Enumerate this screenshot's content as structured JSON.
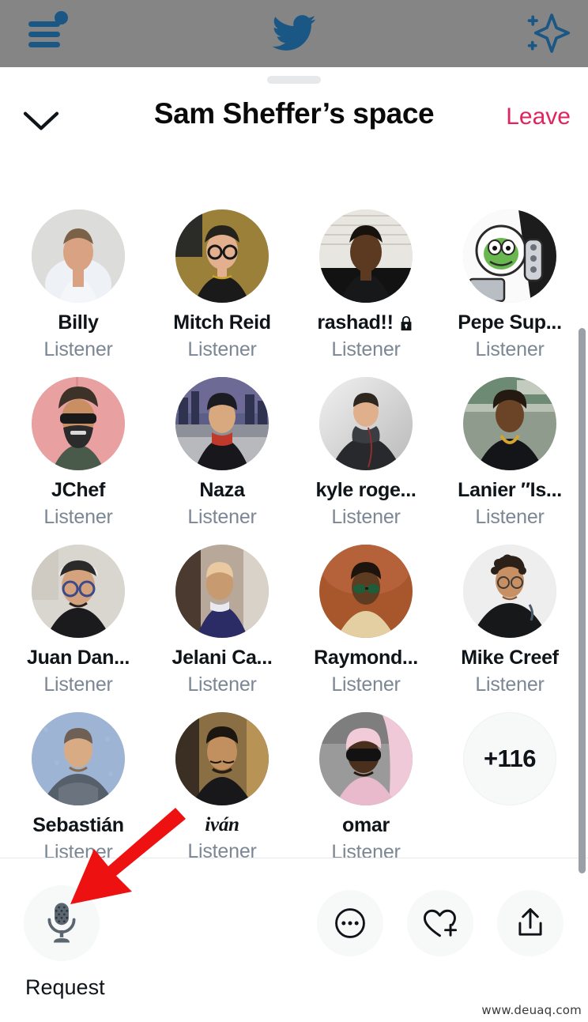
{
  "appbar": {
    "menu_icon": "hamburger-menu-icon",
    "menu_badge": "unread-dot-badge",
    "logo_icon": "twitter-bird-logo",
    "sparkle_icon": "sparkle-highlights-icon",
    "background_color": "#858585",
    "icon_color": "#1a5785"
  },
  "sheet": {
    "drag_handle": "drag-handle",
    "collapse_icon": "chevron-down-icon",
    "title": "Sam Sheffer’s space",
    "leave_label": "Leave",
    "leave_color": "#e0245e"
  },
  "participants": [
    {
      "name": "Billy",
      "role": "Listener",
      "protected": false
    },
    {
      "name": "Mitch Reid",
      "role": "Listener",
      "protected": false
    },
    {
      "name": "rashad!!",
      "role": "Listener",
      "protected": true
    },
    {
      "name": "Pepe Sup...",
      "role": "Listener",
      "protected": false
    },
    {
      "name": "JChef",
      "role": "Listener",
      "protected": false
    },
    {
      "name": "Naza",
      "role": "Listener",
      "protected": false
    },
    {
      "name": "kyle roge...",
      "role": "Listener",
      "protected": false
    },
    {
      "name": "Lanier ″Is...",
      "role": "Listener",
      "protected": false
    },
    {
      "name": "Juan Dan...",
      "role": "Listener",
      "protected": false
    },
    {
      "name": "Jelani Ca...",
      "role": "Listener",
      "protected": false
    },
    {
      "name": "Raymond...",
      "role": "Listener",
      "protected": false
    },
    {
      "name": "Mike Creef",
      "role": "Listener",
      "protected": false
    },
    {
      "name": "Sebastián",
      "role": "Listener",
      "protected": false
    },
    {
      "name": "iván",
      "role": "Listener",
      "protected": false,
      "style": "italic-serif"
    },
    {
      "name": "omar",
      "role": "Listener",
      "protected": false
    }
  ],
  "overflow": {
    "label": "+116"
  },
  "toolbar": {
    "mic_icon": "microphone-icon",
    "request_label": "Request",
    "more_icon": "more-dots-icon",
    "more_label": "More",
    "react_icon": "heart-plus-icon",
    "react_label": "Add reaction",
    "share_icon": "share-upload-icon",
    "share_label": "Share"
  },
  "annotation": {
    "arrow_icon": "red-arrow-annotation",
    "arrow_color": "#ee1111"
  },
  "watermark": {
    "text": "www.deuaq.com"
  }
}
